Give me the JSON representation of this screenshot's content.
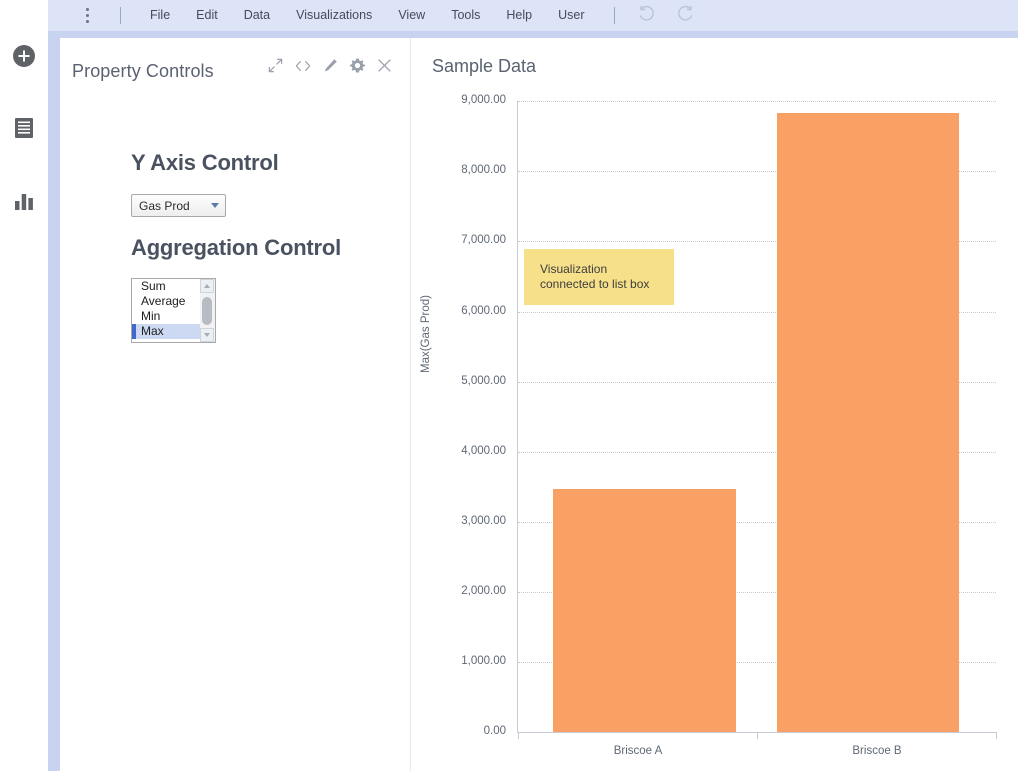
{
  "toolbar": {
    "kebab_icon": "more-vertical-icon",
    "menu_items": [
      {
        "label": "File"
      },
      {
        "label": "Edit"
      },
      {
        "label": "Data"
      },
      {
        "label": "Visualizations"
      },
      {
        "label": "View"
      },
      {
        "label": "Tools"
      },
      {
        "label": "Help"
      },
      {
        "label": "User"
      }
    ],
    "undo_icon": "undo-icon",
    "redo_icon": "redo-icon"
  },
  "rail": {
    "items": [
      {
        "icon": "add-circle-icon"
      },
      {
        "icon": "document-icon"
      },
      {
        "icon": "bar-chart-icon"
      }
    ]
  },
  "property_panel": {
    "title": "Property Controls",
    "header_icons": [
      {
        "icon": "expand-icon"
      },
      {
        "icon": "code-icon"
      },
      {
        "icon": "edit-pencil-icon"
      },
      {
        "icon": "gear-icon"
      },
      {
        "icon": "close-icon"
      }
    ],
    "y_axis_control": {
      "title": "Y Axis Control",
      "dropdown_value": "Gas Prod",
      "dropdown_options": [
        "Gas Prod"
      ]
    },
    "aggregation_control": {
      "title": "Aggregation Control",
      "options": [
        {
          "label": "Sum",
          "selected": false
        },
        {
          "label": "Average",
          "selected": false
        },
        {
          "label": "Min",
          "selected": false
        },
        {
          "label": "Max",
          "selected": true
        }
      ],
      "selected_value": "Max"
    }
  },
  "chart_panel": {
    "title": "Sample Data",
    "annotation": {
      "line1": "Visualization",
      "line2": "connected to list box",
      "color": "#f7e08a"
    }
  },
  "chart_data": {
    "type": "bar",
    "title": "Sample Data",
    "categories": [
      "Briscoe A",
      "Briscoe B"
    ],
    "values": [
      3470,
      8830
    ],
    "series": [
      {
        "name": "Max(Gas Prod)",
        "values": [
          3470,
          8830
        ],
        "color": "#f9a065"
      }
    ],
    "xlabel": "",
    "ylabel": "Max(Gas Prod)",
    "ylim": [
      0,
      9000
    ],
    "yticks": [
      0,
      1000,
      2000,
      3000,
      4000,
      5000,
      6000,
      7000,
      8000,
      9000
    ],
    "ytick_labels": [
      "0.00",
      "1,000.00",
      "2,000.00",
      "3,000.00",
      "4,000.00",
      "5,000.00",
      "6,000.00",
      "7,000.00",
      "8,000.00",
      "9,000.00"
    ],
    "grid": true,
    "legend": false,
    "bar_color": "#f9a065"
  },
  "colors": {
    "accent_green": "#8cc63f",
    "toolbar_bg": "#dde4f7",
    "frame_blue": "#c8d3ef",
    "bar_orange": "#f9a065",
    "annotation_yellow": "#f7e08a",
    "selection_blue": "#cdd8f3",
    "selection_bar": "#4169c9"
  }
}
